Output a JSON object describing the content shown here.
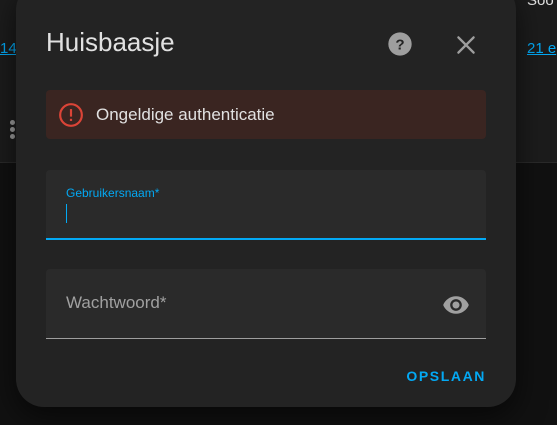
{
  "background": {
    "link_left": "14",
    "link_right": "21 e",
    "text_right": "Soo"
  },
  "dialog": {
    "title": "Huisbaasje",
    "help_icon": "help-circle-icon",
    "close_icon": "close-icon",
    "alert": {
      "icon": "alert-circle-icon",
      "text": "Ongeldige authenticatie",
      "color": "#db4437"
    },
    "fields": {
      "username": {
        "label": "Gebruikersnaam*",
        "value": ""
      },
      "password": {
        "label": "Wachtwoord*",
        "icon": "eye-icon"
      }
    },
    "save_label": "OPSLAAN"
  },
  "colors": {
    "accent": "#03a9f4",
    "error": "#db4437",
    "dialog_bg": "#232323",
    "field_bg": "#2a2a2a"
  }
}
